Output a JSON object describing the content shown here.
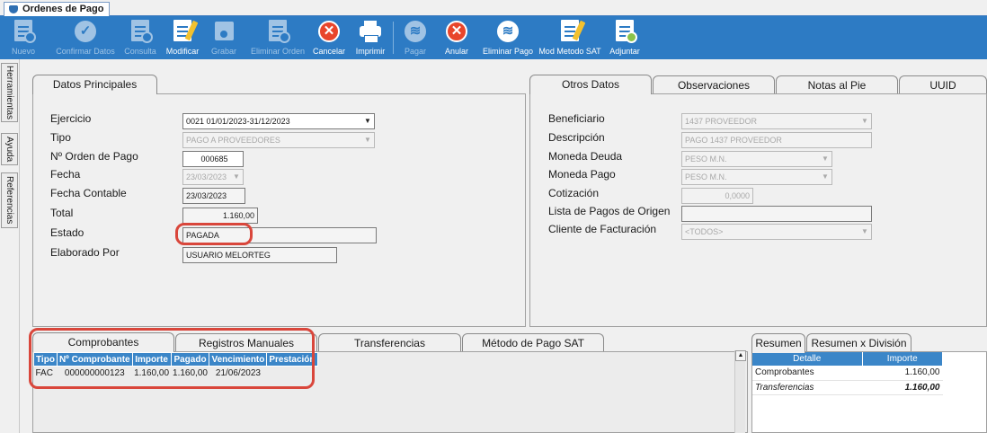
{
  "window": {
    "doc_tab": "Ordenes de Pago"
  },
  "toolbar": [
    {
      "label": "Nuevo",
      "icon": "new-document-icon",
      "enabled": false
    },
    {
      "label": "Confirmar Datos",
      "icon": "checkmark-icon",
      "enabled": false
    },
    {
      "label": "Consulta",
      "icon": "query-document-icon",
      "enabled": false
    },
    {
      "label": "Modificar",
      "icon": "edit-document-icon",
      "enabled": true
    },
    {
      "label": "Grabar",
      "icon": "save-disk-icon",
      "enabled": false
    },
    {
      "label": "Eliminar Orden",
      "icon": "delete-document-icon",
      "enabled": false
    },
    {
      "label": "Cancelar",
      "icon": "cancel-icon",
      "enabled": true
    },
    {
      "label": "Imprimir",
      "icon": "printer-icon",
      "enabled": true
    },
    {
      "label": "Pagar",
      "icon": "pay-coins-icon",
      "enabled": false
    },
    {
      "label": "Anular",
      "icon": "void-icon",
      "enabled": true
    },
    {
      "label": "Eliminar Pago",
      "icon": "delete-payment-icon",
      "enabled": true
    },
    {
      "label": "Mod Metodo SAT",
      "icon": "edit-sat-method-icon",
      "enabled": true
    },
    {
      "label": "Adjuntar",
      "icon": "attach-document-icon",
      "enabled": true
    }
  ],
  "sidebar": {
    "tabs": [
      "Herramientas",
      "Ayuda",
      "Referencias"
    ]
  },
  "datos_principales": {
    "tab": "Datos Principales",
    "labels": {
      "ejercicio": "Ejercicio",
      "tipo": "Tipo",
      "orden": "Nº Orden de Pago",
      "fecha": "Fecha",
      "fecha_contable": "Fecha Contable",
      "total": "Total",
      "estado": "Estado",
      "elaborado": "Elaborado Por"
    },
    "values": {
      "ejercicio": "0021 01/01/2023-31/12/2023",
      "tipo": "PAGO A PROVEEDORES",
      "orden": "000685",
      "fecha": "23/03/2023",
      "fecha_contable": "23/03/2023",
      "total": "1.160,00",
      "estado": "PAGADA",
      "elaborado": "USUARIO MELORTEG"
    }
  },
  "otros": {
    "tabs": [
      "Otros Datos",
      "Observaciones",
      "Notas al Pie",
      "UUID"
    ],
    "labels": {
      "beneficiario": "Beneficiario",
      "descripcion": "Descripción",
      "moneda_deuda": "Moneda Deuda",
      "moneda_pago": "Moneda Pago",
      "cotizacion": "Cotización",
      "lista_pagos": "Lista de Pagos de Origen",
      "cliente": "Cliente de Facturación"
    },
    "values": {
      "beneficiario": "1437 PROVEEDOR",
      "descripcion": "PAGO 1437 PROVEEDOR",
      "moneda_deuda": "PESO M.N.",
      "moneda_pago": "PESO M.N.",
      "cotizacion": "0,0000",
      "lista_pagos": "",
      "cliente": "<TODOS>"
    }
  },
  "detail": {
    "tabs": [
      "Comprobantes",
      "Registros Manuales",
      "Transferencias",
      "Método de Pago SAT"
    ],
    "columns": [
      "Tipo",
      "Nº Comprobante",
      "Importe",
      "Pagado",
      "Vencimiento",
      "Prestación"
    ],
    "rows": [
      [
        "FAC",
        "000000000123",
        "1.160,00",
        "1.160,00",
        "21/06/2023",
        ""
      ]
    ]
  },
  "summary": {
    "tabs": [
      "Resumen",
      "Resumen x División"
    ],
    "columns": [
      "Detalle",
      "Importe"
    ],
    "rows": [
      {
        "detalle": "Comprobantes",
        "importe": "1.160,00"
      },
      {
        "detalle": "Transferencias",
        "importe": "1.160,00"
      }
    ]
  },
  "colors": {
    "toolbar": "#2d7bc4",
    "grid_header": "#3b86c8",
    "highlight": "#d9463b"
  }
}
